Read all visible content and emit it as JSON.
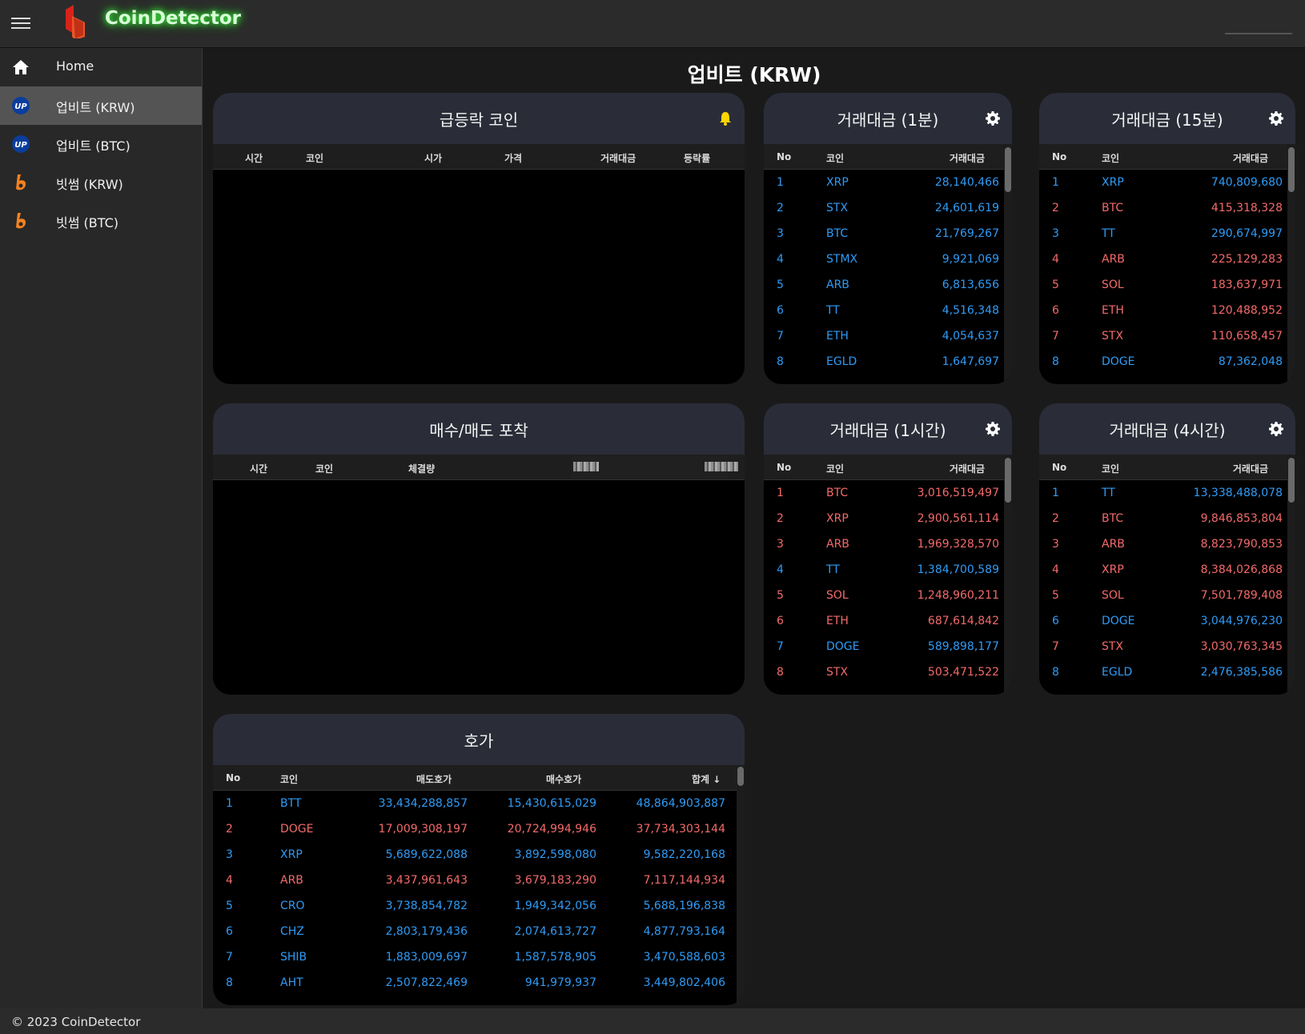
{
  "app": {
    "name": "CoinDetector",
    "page_title": "업비트 (KRW)",
    "footer": "© 2023 CoinDetector"
  },
  "sidebar": {
    "items": [
      {
        "label": "Home",
        "icon": "home-icon"
      },
      {
        "label": "업비트 (KRW)",
        "icon": "upbit-icon",
        "active": true
      },
      {
        "label": "업비트 (BTC)",
        "icon": "upbit-icon"
      },
      {
        "label": "빗썸 (KRW)",
        "icon": "bithumb-icon"
      },
      {
        "label": "빗썸 (BTC)",
        "icon": "bithumb-icon"
      }
    ]
  },
  "colors": {
    "up": "#2f9bf5",
    "down": "#f36a6a",
    "panel_head": "#2a2d38",
    "bell": "#ffd600"
  },
  "surge": {
    "title": "급등락 코인",
    "headers": [
      "시간",
      "코인",
      "시가",
      "가격",
      "거래대금",
      "등락률"
    ]
  },
  "catch": {
    "title": "매수/매도 포착",
    "headers": [
      "시간",
      "코인",
      "체결량"
    ]
  },
  "vol1m": {
    "title": "거래대금 (1분)",
    "headers": [
      "No",
      "코인",
      "거래대금"
    ],
    "rows": [
      {
        "no": "1",
        "coin": "XRP",
        "value": "28,140,466",
        "dir": "up"
      },
      {
        "no": "2",
        "coin": "STX",
        "value": "24,601,619",
        "dir": "up"
      },
      {
        "no": "3",
        "coin": "BTC",
        "value": "21,769,267",
        "dir": "up"
      },
      {
        "no": "4",
        "coin": "STMX",
        "value": "9,921,069",
        "dir": "up"
      },
      {
        "no": "5",
        "coin": "ARB",
        "value": "6,813,656",
        "dir": "up"
      },
      {
        "no": "6",
        "coin": "TT",
        "value": "4,516,348",
        "dir": "up"
      },
      {
        "no": "7",
        "coin": "ETH",
        "value": "4,054,637",
        "dir": "up"
      },
      {
        "no": "8",
        "coin": "EGLD",
        "value": "1,647,697",
        "dir": "up"
      }
    ]
  },
  "vol15m": {
    "title": "거래대금 (15분)",
    "headers": [
      "No",
      "코인",
      "거래대금"
    ],
    "rows": [
      {
        "no": "1",
        "coin": "XRP",
        "value": "740,809,680",
        "dir": "up"
      },
      {
        "no": "2",
        "coin": "BTC",
        "value": "415,318,328",
        "dir": "down"
      },
      {
        "no": "3",
        "coin": "TT",
        "value": "290,674,997",
        "dir": "up"
      },
      {
        "no": "4",
        "coin": "ARB",
        "value": "225,129,283",
        "dir": "down"
      },
      {
        "no": "5",
        "coin": "SOL",
        "value": "183,637,971",
        "dir": "down"
      },
      {
        "no": "6",
        "coin": "ETH",
        "value": "120,488,952",
        "dir": "down"
      },
      {
        "no": "7",
        "coin": "STX",
        "value": "110,658,457",
        "dir": "down"
      },
      {
        "no": "8",
        "coin": "DOGE",
        "value": "87,362,048",
        "dir": "up"
      }
    ]
  },
  "vol1h": {
    "title": "거래대금 (1시간)",
    "headers": [
      "No",
      "코인",
      "거래대금"
    ],
    "rows": [
      {
        "no": "1",
        "coin": "BTC",
        "value": "3,016,519,497",
        "dir": "down"
      },
      {
        "no": "2",
        "coin": "XRP",
        "value": "2,900,561,114",
        "dir": "down"
      },
      {
        "no": "3",
        "coin": "ARB",
        "value": "1,969,328,570",
        "dir": "down"
      },
      {
        "no": "4",
        "coin": "TT",
        "value": "1,384,700,589",
        "dir": "up"
      },
      {
        "no": "5",
        "coin": "SOL",
        "value": "1,248,960,211",
        "dir": "down"
      },
      {
        "no": "6",
        "coin": "ETH",
        "value": "687,614,842",
        "dir": "down"
      },
      {
        "no": "7",
        "coin": "DOGE",
        "value": "589,898,177",
        "dir": "up"
      },
      {
        "no": "8",
        "coin": "STX",
        "value": "503,471,522",
        "dir": "down"
      }
    ]
  },
  "vol4h": {
    "title": "거래대금 (4시간)",
    "headers": [
      "No",
      "코인",
      "거래대금"
    ],
    "rows": [
      {
        "no": "1",
        "coin": "TT",
        "value": "13,338,488,078",
        "dir": "up"
      },
      {
        "no": "2",
        "coin": "BTC",
        "value": "9,846,853,804",
        "dir": "down"
      },
      {
        "no": "3",
        "coin": "ARB",
        "value": "8,823,790,853",
        "dir": "down"
      },
      {
        "no": "4",
        "coin": "XRP",
        "value": "8,384,026,868",
        "dir": "down"
      },
      {
        "no": "5",
        "coin": "SOL",
        "value": "7,501,789,408",
        "dir": "down"
      },
      {
        "no": "6",
        "coin": "DOGE",
        "value": "3,044,976,230",
        "dir": "up"
      },
      {
        "no": "7",
        "coin": "STX",
        "value": "3,030,763,345",
        "dir": "down"
      },
      {
        "no": "8",
        "coin": "EGLD",
        "value": "2,476,385,586",
        "dir": "up"
      }
    ]
  },
  "orderbook": {
    "title": "호가",
    "headers": [
      "No",
      "코인",
      "매도호가",
      "매수호가",
      "합계"
    ],
    "rows": [
      {
        "no": "1",
        "coin": "BTT",
        "ask": "33,434,288,857",
        "bid": "15,430,615,029",
        "total": "48,864,903,887",
        "dir": "up"
      },
      {
        "no": "2",
        "coin": "DOGE",
        "ask": "17,009,308,197",
        "bid": "20,724,994,946",
        "total": "37,734,303,144",
        "dir": "down"
      },
      {
        "no": "3",
        "coin": "XRP",
        "ask": "5,689,622,088",
        "bid": "3,892,598,080",
        "total": "9,582,220,168",
        "dir": "up"
      },
      {
        "no": "4",
        "coin": "ARB",
        "ask": "3,437,961,643",
        "bid": "3,679,183,290",
        "total": "7,117,144,934",
        "dir": "down"
      },
      {
        "no": "5",
        "coin": "CRO",
        "ask": "3,738,854,782",
        "bid": "1,949,342,056",
        "total": "5,688,196,838",
        "dir": "up"
      },
      {
        "no": "6",
        "coin": "CHZ",
        "ask": "2,803,179,436",
        "bid": "2,074,613,727",
        "total": "4,877,793,164",
        "dir": "up"
      },
      {
        "no": "7",
        "coin": "SHIB",
        "ask": "1,883,009,697",
        "bid": "1,587,578,905",
        "total": "3,470,588,603",
        "dir": "up"
      },
      {
        "no": "8",
        "coin": "AHT",
        "ask": "2,507,822,469",
        "bid": "941,979,937",
        "total": "3,449,802,406",
        "dir": "up"
      }
    ]
  }
}
